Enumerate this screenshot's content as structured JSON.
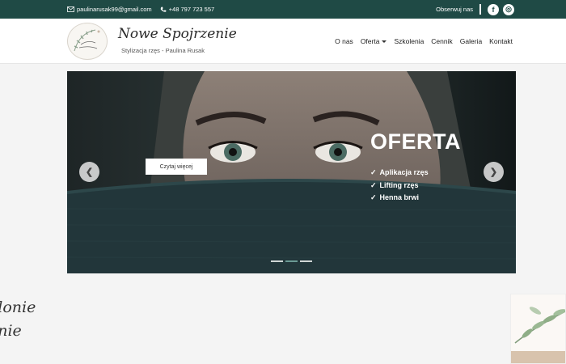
{
  "topbar": {
    "email": "paulinarusak99@gmail.com",
    "phone": "+48 797 723 557",
    "follow_label": "Obserwuj nas",
    "social": [
      {
        "icon": "facebook-icon",
        "glyph": "f"
      },
      {
        "icon": "instagram-icon",
        "glyph": "◎"
      }
    ]
  },
  "header": {
    "title": "Nowe Spojrzenie",
    "subtitle": "Stylizacja rzęs - Paulina Rusak",
    "nav": [
      {
        "label": "O nas"
      },
      {
        "label": "Oferta",
        "dropdown": true
      },
      {
        "label": "Szkolenia"
      },
      {
        "label": "Cennik"
      },
      {
        "label": "Galeria"
      },
      {
        "label": "Kontakt"
      }
    ]
  },
  "hero": {
    "button_label": "Czytaj więcej",
    "heading": "OFERTA",
    "items": [
      "Aplikacja rzęs",
      "Lifting rzęs",
      "Henna brwi"
    ],
    "slides": 3,
    "active_slide": 2,
    "prev_glyph": "❮",
    "next_glyph": "❯"
  },
  "section": {
    "line1": "elonie",
    "line2": "enie"
  },
  "colors": {
    "topbar": "#1f4a45",
    "background": "#f4f4f4"
  }
}
